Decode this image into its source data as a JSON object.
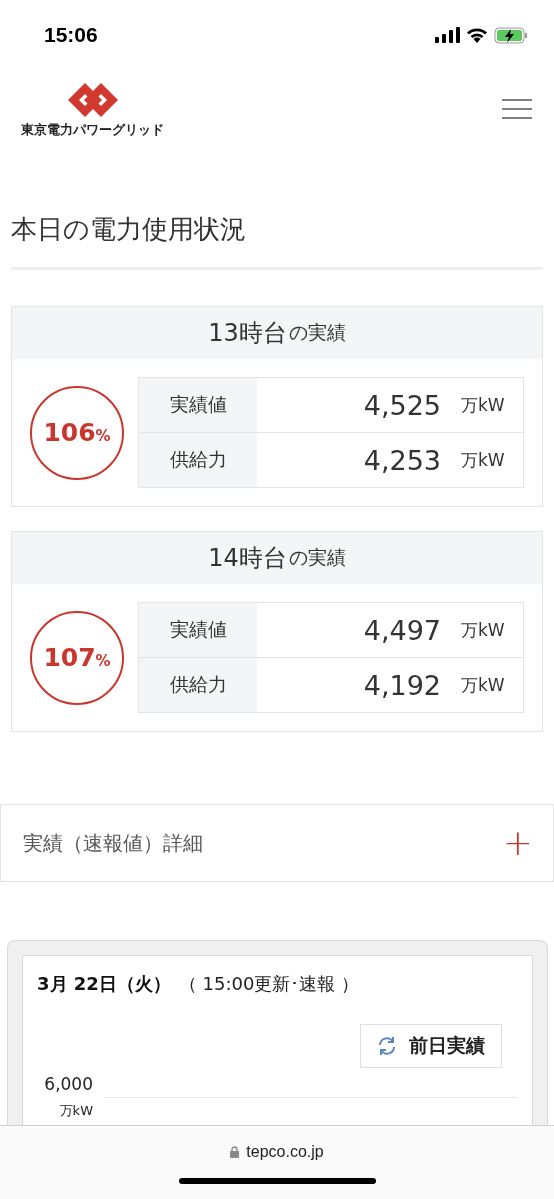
{
  "status_bar": {
    "time": "15:06"
  },
  "header": {
    "logo_text": "東京電力パワーグリッド"
  },
  "page_title": "本日の電力使用状況",
  "cards": [
    {
      "title_main": "13時台",
      "title_suffix": "の実績",
      "percent": "106",
      "percent_sign": "%",
      "rows": [
        {
          "label": "実績値",
          "value": "4,525",
          "unit": "万kW"
        },
        {
          "label": "供給力",
          "value": "4,253",
          "unit": "万kW"
        }
      ]
    },
    {
      "title_main": "14時台",
      "title_suffix": "の実績",
      "percent": "107",
      "percent_sign": "%",
      "rows": [
        {
          "label": "実績値",
          "value": "4,497",
          "unit": "万kW"
        },
        {
          "label": "供給力",
          "value": "4,192",
          "unit": "万kW"
        }
      ]
    }
  ],
  "accordion": {
    "label": "実績（速報値）詳細",
    "expanded": false,
    "toggle": "+"
  },
  "chart_panel": {
    "date": "3月 22日（火）",
    "update": "（ 15:00更新･速報 ）",
    "button": "前日実績",
    "y_tick": "6,000",
    "y_unit": "万kW"
  },
  "browser_bar": {
    "url": "tepco.co.jp"
  }
}
